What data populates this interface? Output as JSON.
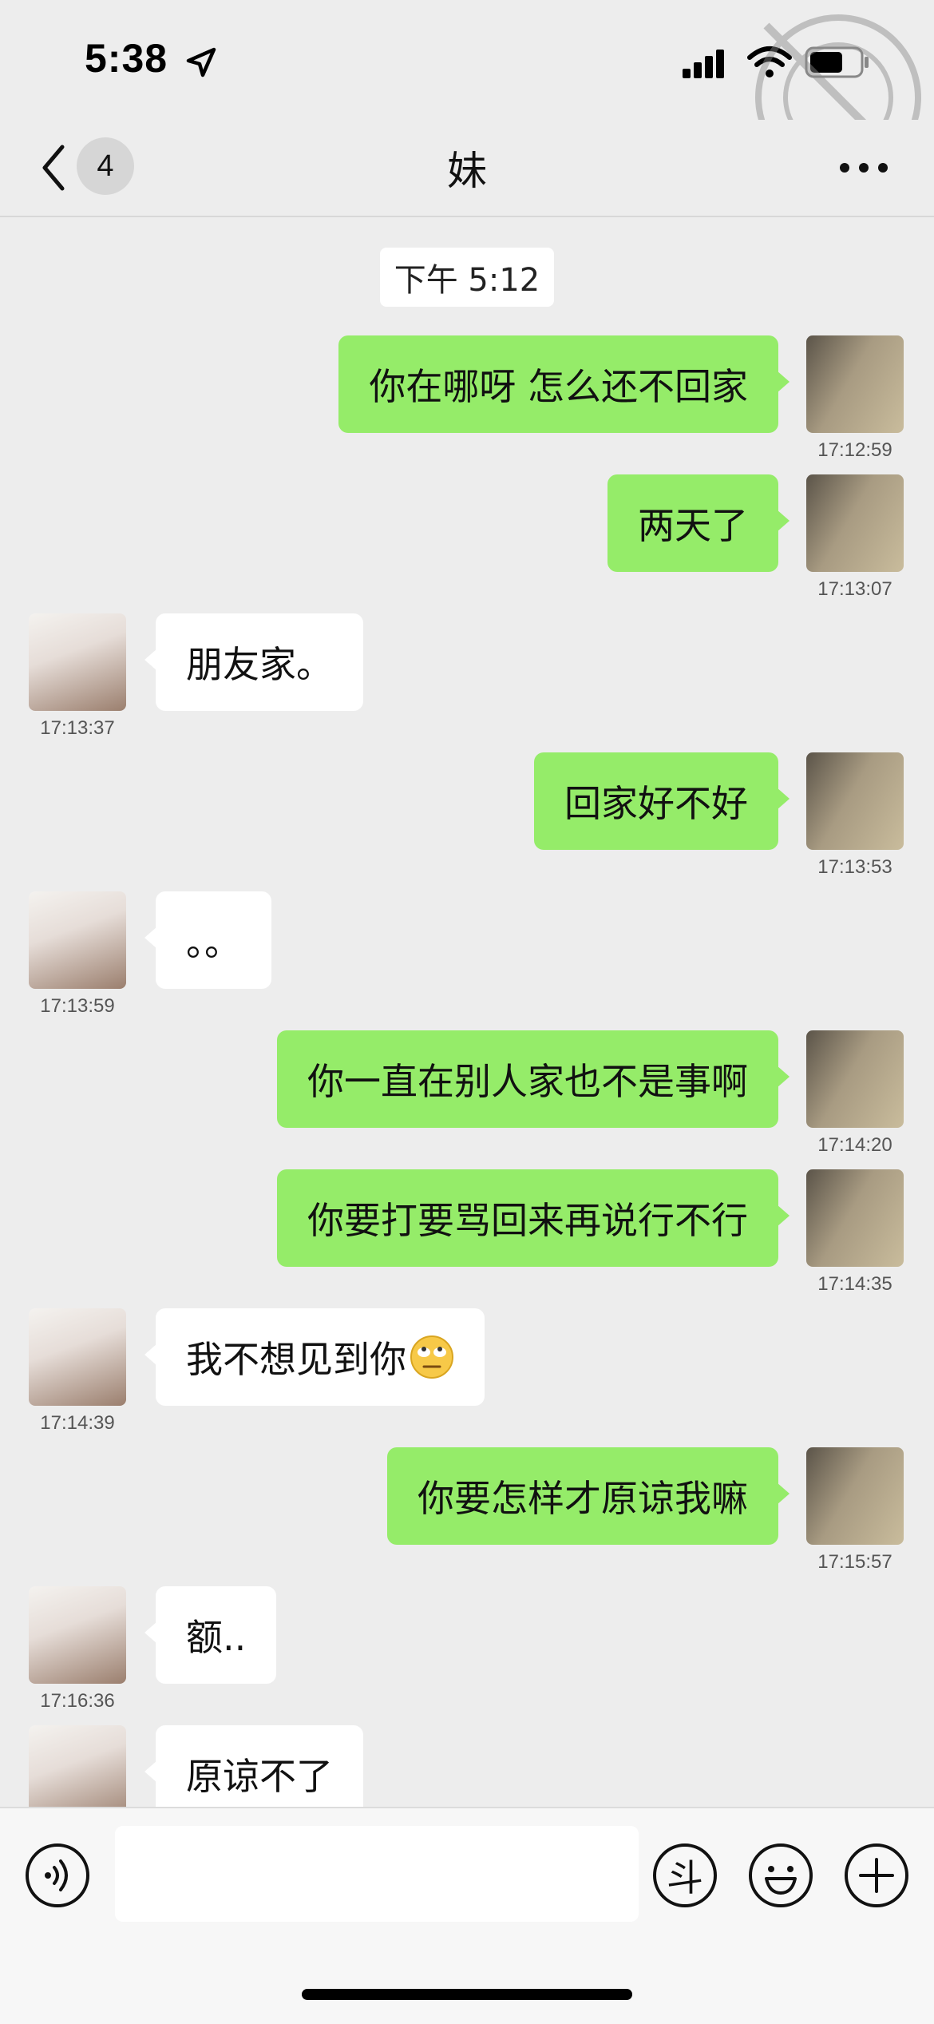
{
  "status_bar": {
    "time": "5:38"
  },
  "nav": {
    "unread_count": "4",
    "title": "妹"
  },
  "chat": {
    "time_divider": "下午 5:12",
    "messages": [
      {
        "from": "me",
        "text": "你在哪呀 怎么还不回家",
        "time": "17:12:59"
      },
      {
        "from": "me",
        "text": "两天了",
        "time": "17:13:07"
      },
      {
        "from": "her",
        "text": "朋友家。",
        "time": "17:13:37"
      },
      {
        "from": "me",
        "text": "回家好不好",
        "time": "17:13:53"
      },
      {
        "from": "her",
        "text": "。。",
        "time": "17:13:59"
      },
      {
        "from": "me",
        "text": "你一直在别人家也不是事啊",
        "time": "17:14:20"
      },
      {
        "from": "me",
        "text": "你要打要骂回来再说行不行",
        "time": "17:14:35"
      },
      {
        "from": "her",
        "text": "我不想见到你",
        "emoji": "eye-roll-emoji",
        "time": "17:14:39"
      },
      {
        "from": "me",
        "text": "你要怎样才原谅我嘛",
        "time": "17:15:57"
      },
      {
        "from": "her",
        "text": "额..",
        "time": "17:16:36"
      },
      {
        "from": "her",
        "text": "原谅不了",
        "time": ""
      }
    ]
  },
  "input_bar": {
    "placeholder": "",
    "dou_label": "斗",
    "icons": [
      "voice-icon",
      "dou-icon",
      "emoji-icon",
      "plus-icon"
    ]
  },
  "colors": {
    "background": "#ededed",
    "outgoing_bubble": "#95ec69",
    "incoming_bubble": "#ffffff"
  }
}
